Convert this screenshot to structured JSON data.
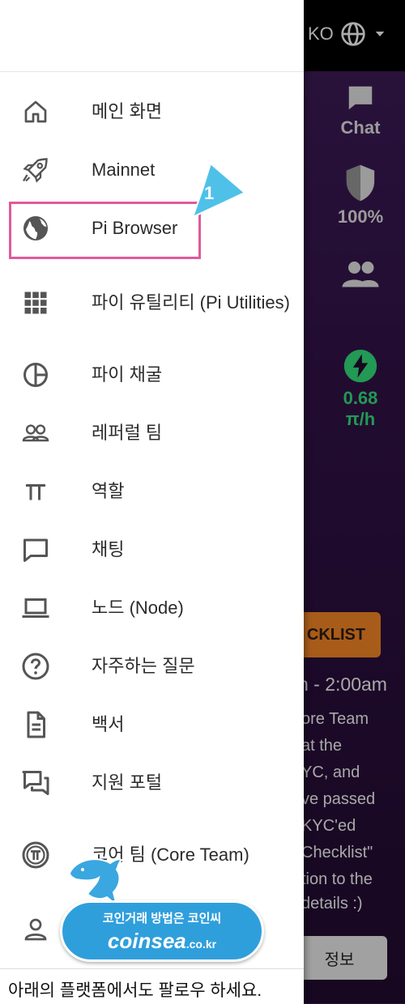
{
  "background": {
    "lang_code": "KO",
    "rail": {
      "chat_label": "Chat",
      "security_label": "100%",
      "mining_rate": "0.68",
      "mining_unit": "π/h"
    },
    "checklist_label": "CKLIST",
    "time_text": "n - 2:00am",
    "lines": [
      "ore Team",
      "at the",
      "YC, and",
      "ve passed",
      "KYC'ed",
      "Checklist\"",
      "tion to the",
      "details :)"
    ],
    "info_button": "정보"
  },
  "drawer": {
    "menu": [
      {
        "icon": "home-icon",
        "label": "메인 화면"
      },
      {
        "icon": "rocket-icon",
        "label": "Mainnet"
      },
      {
        "icon": "globe-icon",
        "label": "Pi Browser"
      },
      {
        "icon": "grid-icon",
        "label": "파이 유틸리티 (Pi Utilities)"
      },
      {
        "icon": "pie-chart-icon",
        "label": "파이 채굴"
      },
      {
        "icon": "referral-team-icon",
        "label": "레퍼럴 팀"
      },
      {
        "icon": "pi-icon",
        "label": "역할"
      },
      {
        "icon": "chat-bubble-icon",
        "label": "채팅"
      },
      {
        "icon": "laptop-icon",
        "label": "노드 (Node)"
      },
      {
        "icon": "help-icon",
        "label": "자주하는 질문"
      },
      {
        "icon": "document-icon",
        "label": "백서"
      },
      {
        "icon": "support-icon",
        "label": "지원 포털"
      },
      {
        "icon": "pi-coin-icon",
        "label": "코어 팀 (Core Team)"
      },
      {
        "icon": "person-icon",
        "label": ""
      }
    ],
    "footer_text": "아래의 플랫폼에서도 팔로우 하세요."
  },
  "annotation": {
    "callout_number": "1",
    "highlight_color": "#e05a9a",
    "callout_color": "#4fc1e9"
  },
  "watermark": {
    "line1": "코인거래 방법은 코인씨",
    "line2": "coinsea",
    "domain": ".co.kr"
  }
}
